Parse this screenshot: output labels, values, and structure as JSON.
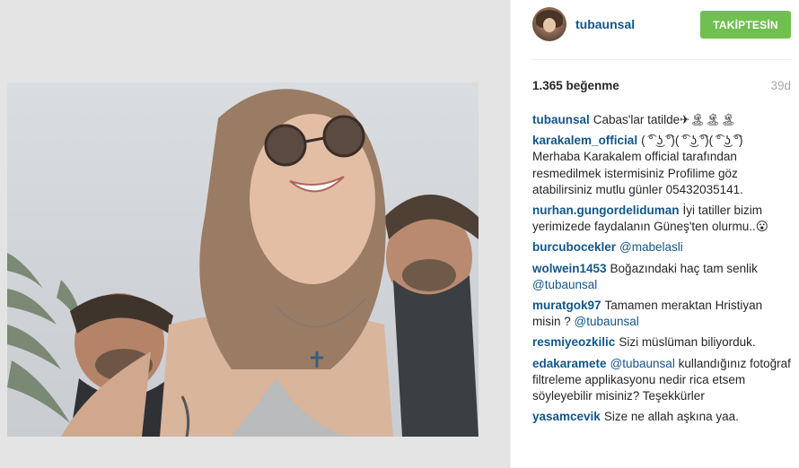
{
  "post": {
    "username": "tubaunsal",
    "follow_label": "TAKİPTESİN",
    "likes_text": "1.365 beğenme",
    "age_text": "39d"
  },
  "colors": {
    "follow_green": "#70c050",
    "link_blue": "#125688",
    "muted": "#a5a7aa",
    "media_bg": "#e4e4e4"
  },
  "comments": [
    {
      "user": "tubaunsal",
      "text": "Cabas'lar tatilde✈🏝🏝🏝",
      "mention": ""
    },
    {
      "user": "karakalem_official",
      "text": "( ͡° ͜ʖ ͡°)( ͡° ͜ʖ ͡°)( ͡° ͜ʖ ͡°) Merhaba Karakalem official tarafından resmedilmek istermisiniz Profilime göz atabilirsiniz mutlu günler 05432035141.",
      "mention": ""
    },
    {
      "user": "nurhan.gungordeliduman",
      "text": "İyi tatiller bizim yerimizede faydalanın Güneş'ten olurmu..😮",
      "mention": ""
    },
    {
      "user": "burcubocekler",
      "text": "",
      "mention": "@mabelasli"
    },
    {
      "user": "wolwein1453",
      "text": "Boğazındaki haç tam senlik",
      "mention": "@tubaunsal"
    },
    {
      "user": "muratgok97",
      "text": "Tamamen meraktan Hristiyan misin ?",
      "mention": "@tubaunsal"
    },
    {
      "user": "resmiyeozkilic",
      "text": "Sizi müslüman biliyorduk.",
      "mention": ""
    },
    {
      "user": "edakaramete",
      "text": "kullandığınız fotoğraf filtreleme applikasyonu nedir rica etsem söyleyebilir misiniz? Teşekkürler",
      "mention": "@tubaunsal",
      "mention_first": true
    },
    {
      "user": "yasamcevik",
      "text": "Size ne allah aşkına yaa.",
      "mention": ""
    }
  ]
}
